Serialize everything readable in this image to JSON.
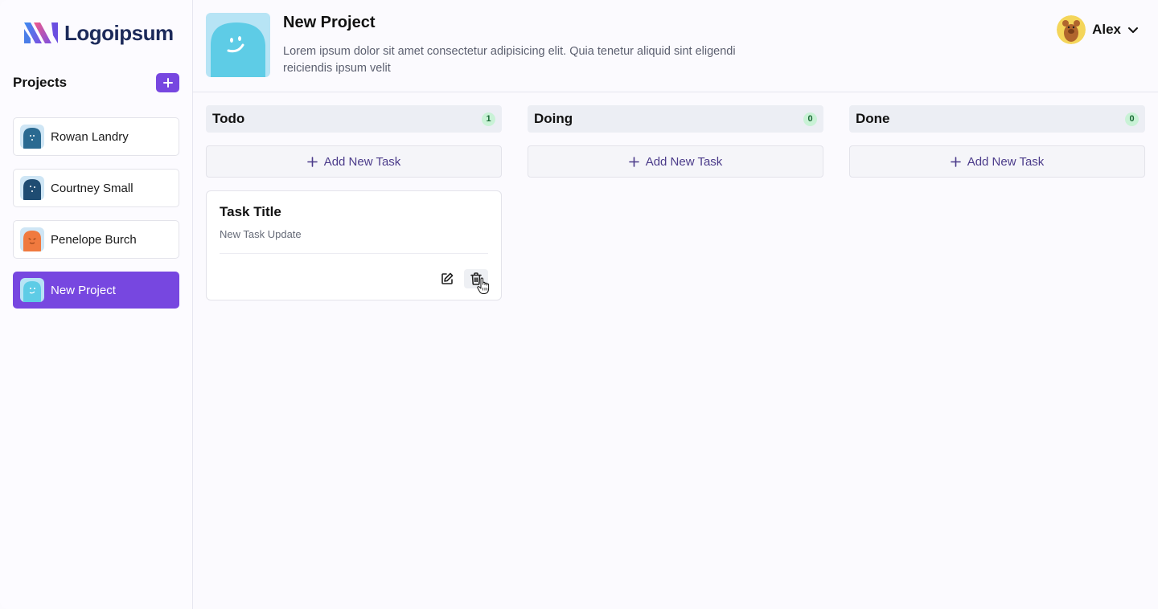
{
  "brand": {
    "name": "Logoipsum"
  },
  "sidebar": {
    "heading": "Projects",
    "items": [
      {
        "label": "Rowan Landry",
        "color": "#2a6a91"
      },
      {
        "label": "Courtney Small",
        "color": "#1f4c72"
      },
      {
        "label": "Penelope Burch",
        "color": "#f07a3f"
      },
      {
        "label": "New Project",
        "color": "#5ecce6",
        "active": true
      }
    ]
  },
  "header": {
    "title": "New Project",
    "description": "Lorem ipsum dolor sit amet consectetur adipisicing elit. Quia tenetur aliquid sint eligendi reiciendis ipsum velit"
  },
  "user": {
    "name": "Alex"
  },
  "columns": [
    {
      "title": "Todo",
      "count": "1",
      "add_label": "Add New Task"
    },
    {
      "title": "Doing",
      "count": "0",
      "add_label": "Add New Task"
    },
    {
      "title": "Done",
      "count": "0",
      "add_label": "Add New Task"
    }
  ],
  "task": {
    "title": "Task Title",
    "description": "New Task Update"
  },
  "colors": {
    "accent": "#7747e0",
    "badge_bg": "#c9f2d6",
    "badge_text": "#1a6a35"
  }
}
